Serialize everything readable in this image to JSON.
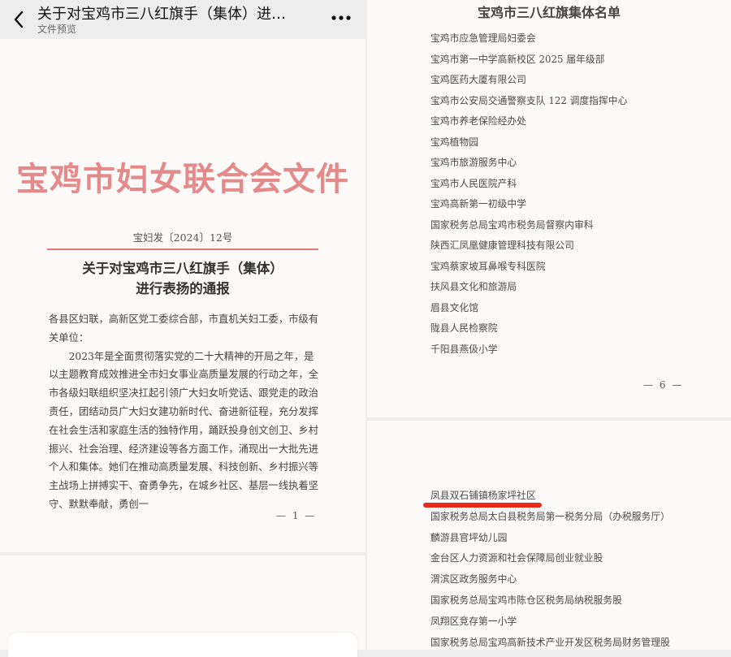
{
  "header": {
    "title": "关于对宝鸡市三八红旗手（集体）进…",
    "subtitle": "文件预览"
  },
  "left_page": {
    "doc_header": "宝鸡市妇女联合会文件",
    "doc_number": "宝妇发〔2024〕12号",
    "notice_title_line1": "关于对宝鸡市三八红旗手（集体）",
    "notice_title_line2": "进行表扬的通报",
    "salutation": "各县区妇联，高新区党工委综合部，市直机关妇工委，市级有关单位：",
    "paragraph": "2023年是全面贯彻落实党的二十大精神的开局之年，是以主题教育成效推进全市妇女事业高质量发展的行动之年，全市各级妇联组织坚决扛起引领广大妇女听党话、跟党走的政治责任，团结动员广大妇女建功新时代、奋进新征程，充分发挥在社会生活和家庭生活的独特作用，踊跃投身创文创卫、乡村振兴、社会治理、经济建设等各方面工作，涌现出一大批先进个人和集体。她们在推动高质量发展、科技创新、乡村振兴等主战场上拼搏实干、奋勇争先，在城乡社区、基层一线执着坚守、默默奉献，勇创一",
    "page_number": "— 1 —"
  },
  "right_page": {
    "heading": "宝鸡市三八红旗集体名单",
    "list_top": [
      "宝鸡市应急管理局妇委会",
      "宝鸡市第一中学高新校区 2025 届年级部",
      "宝鸡医药大厦有限公司",
      "宝鸡市公安局交通警察支队 122 调度指挥中心",
      "宝鸡市养老保险经办处",
      "宝鸡植物园",
      "宝鸡市旅游服务中心",
      "宝鸡市人民医院产科",
      "宝鸡高新第一初级中学",
      "国家税务总局宝鸡市税务局督察内审科",
      "陕西汇凤凰健康管理科技有限公司",
      "宝鸡蔡家坡耳鼻喉专科医院",
      "扶风县文化和旅游局",
      "眉县文化馆",
      "陇县人民检察院",
      "千阳县燕伋小学"
    ],
    "page_number": "— 6 —",
    "list_bottom": [
      "凤县双石铺镇杨家坪社区",
      "国家税务总局太白县税务局第一税务分局（办税服务厅）",
      "麟游县官坪幼儿园",
      "金台区人力资源和社会保障局创业就业股",
      "渭滨区政务服务中心",
      "国家税务总局宝鸡市陈仓区税务局纳税服务股",
      "凤翔区竞存第一小学",
      "国家税务总局宝鸡高新技术产业开发区税务局财务管理股"
    ]
  },
  "colors": {
    "doc_header": "#e58a8a",
    "red_rule": "#e07878",
    "highlight_underline": "#e82a1c",
    "page_bg": "#fbfaf8"
  }
}
